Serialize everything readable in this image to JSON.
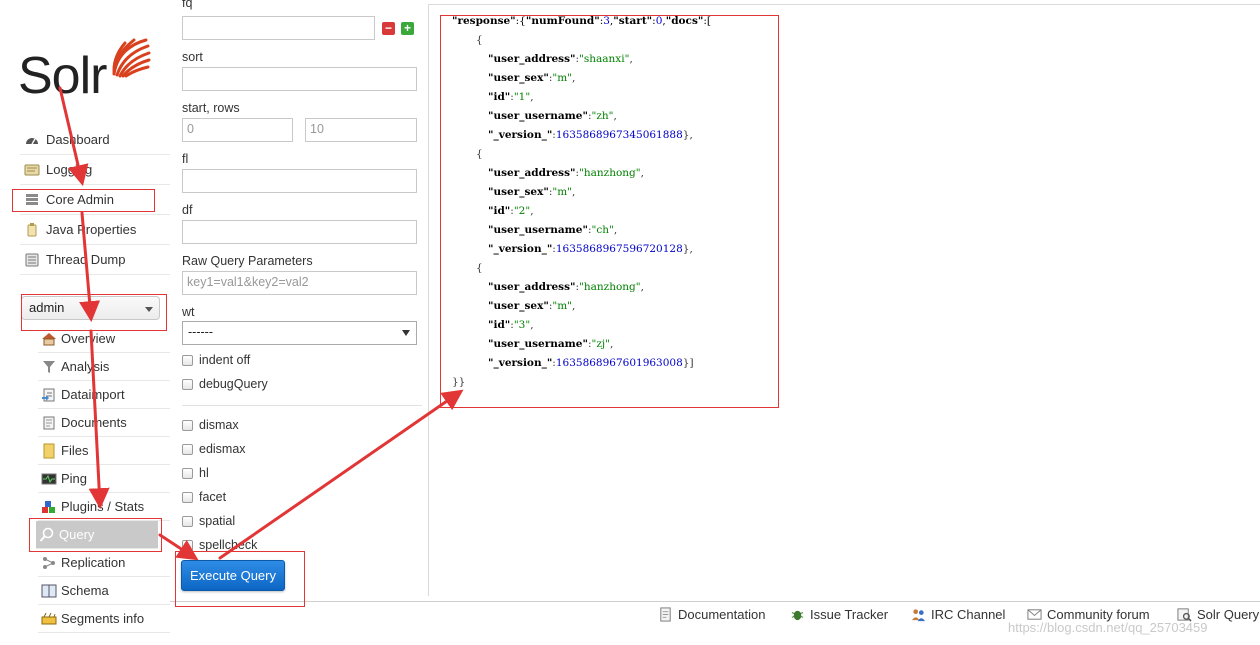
{
  "logo": {
    "text": "Solr"
  },
  "menu": [
    {
      "label": "Dashboard",
      "icon": "dashboard-icon"
    },
    {
      "label": "Logging",
      "icon": "logging-icon"
    },
    {
      "label": "Core Admin",
      "icon": "core-admin-icon"
    },
    {
      "label": "Java Properties",
      "icon": "java-icon"
    },
    {
      "label": "Thread Dump",
      "icon": "thread-dump-icon"
    }
  ],
  "core_selector": {
    "value": "admin"
  },
  "core_menu": [
    {
      "label": "Overview",
      "icon": "home-icon"
    },
    {
      "label": "Analysis",
      "icon": "funnel-icon"
    },
    {
      "label": "Dataimport",
      "icon": "dataimport-icon"
    },
    {
      "label": "Documents",
      "icon": "documents-icon"
    },
    {
      "label": "Files",
      "icon": "folder-icon"
    },
    {
      "label": "Ping",
      "icon": "ping-icon"
    },
    {
      "label": "Plugins / Stats",
      "icon": "plugins-icon"
    },
    {
      "label": "Query",
      "icon": "search-icon"
    },
    {
      "label": "Replication",
      "icon": "replication-icon"
    },
    {
      "label": "Schema",
      "icon": "schema-icon"
    },
    {
      "label": "Segments info",
      "icon": "segments-icon"
    }
  ],
  "form": {
    "fq_label": "fq",
    "sort_label": "sort",
    "start_rows_label": "start, rows",
    "start_value": "0",
    "rows_value": "10",
    "fl_label": "fl",
    "df_label": "df",
    "raw_label": "Raw Query Parameters",
    "raw_placeholder": "key1=val1&key2=val2",
    "wt_label": "wt",
    "wt_value": "------",
    "indent_label": "indent off",
    "debug_label": "debugQuery",
    "dismax_label": "dismax",
    "edismax_label": "edismax",
    "hl_label": "hl",
    "facet_label": "facet",
    "spatial_label": "spatial",
    "spellcheck_label": "spellcheck",
    "execute_label": "Execute Query",
    "remove_symbol": "−",
    "add_symbol": "+"
  },
  "response": {
    "numFound": 3,
    "start": 0,
    "docs": [
      {
        "user_address": "shaanxi",
        "user_sex": "m",
        "id": "1",
        "user_username": "zh",
        "_version_": "1635868967345061888"
      },
      {
        "user_address": "hanzhong",
        "user_sex": "m",
        "id": "2",
        "user_username": "ch",
        "_version_": "1635868967596720128"
      },
      {
        "user_address": "hanzhong",
        "user_sex": "m",
        "id": "3",
        "user_username": "zj",
        "_version_": "1635868967601963008"
      }
    ]
  },
  "footer": [
    {
      "label": "Documentation",
      "icon": "document-icon"
    },
    {
      "label": "Issue Tracker",
      "icon": "bug-icon"
    },
    {
      "label": "IRC Channel",
      "icon": "people-icon"
    },
    {
      "label": "Community forum",
      "icon": "mail-icon"
    },
    {
      "label": "Solr Query",
      "icon": "query-icon"
    }
  ],
  "watermark": "https://blog.csdn.net/qq_25703459",
  "colors": {
    "annotation": "#e23636",
    "execute": "#1479d6",
    "brand": "#d9411e"
  }
}
